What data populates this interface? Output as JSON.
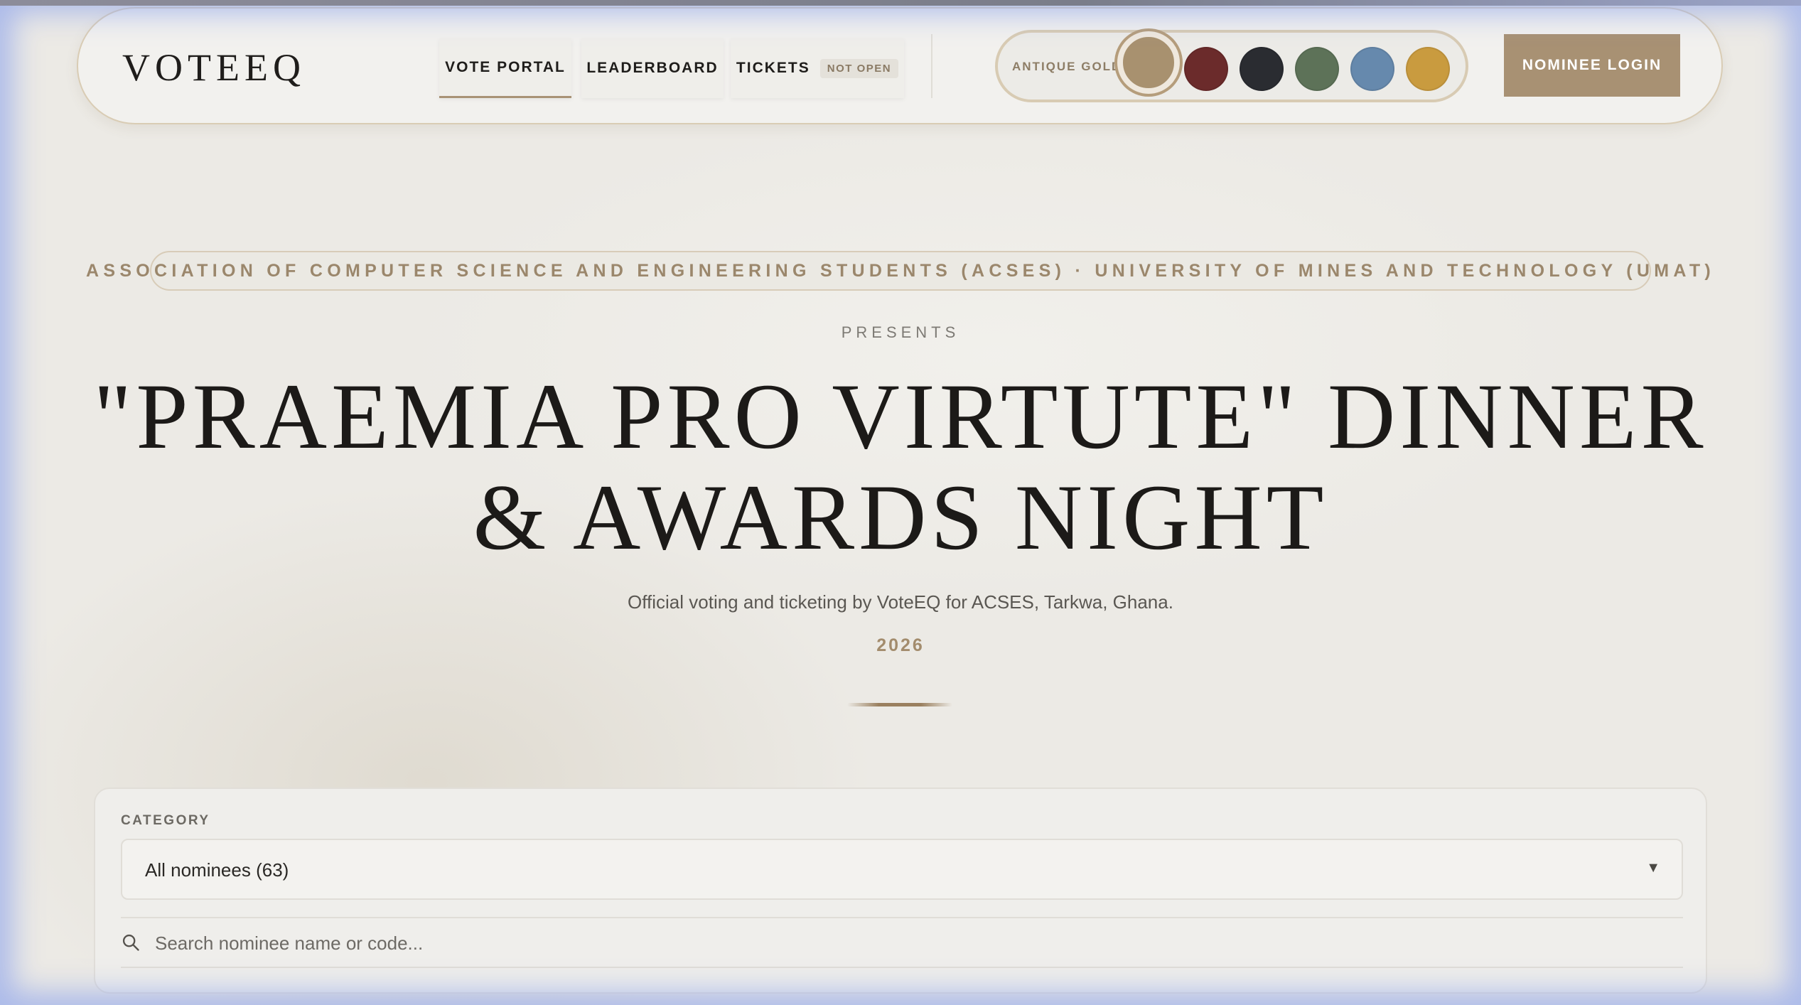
{
  "brand": {
    "logo": "VOTEEQ"
  },
  "nav": {
    "tabs": [
      {
        "label": "VOTE PORTAL",
        "active": true
      },
      {
        "label": "LEADERBOARD",
        "active": false
      },
      {
        "label": "TICKETS",
        "badge": "NOT OPEN",
        "active": false
      }
    ],
    "theme": {
      "selected_label": "ANTIQUE GOLD",
      "swatches": [
        "#a8916f",
        "#6b2b2b",
        "#2a2c31",
        "#5d7258",
        "#6689ad",
        "#c99b3f"
      ]
    },
    "login_button": "NOMINEE LOGIN"
  },
  "hero": {
    "organization": "ASSOCIATION OF COMPUTER SCIENCE AND ENGINEERING STUDENTS (ACSES) · UNIVERSITY OF MINES AND TECHNOLOGY (UMAT)",
    "presents": "PRESENTS",
    "title_line1": "\"PRAEMIA PRO VIRTUTE\" DINNER",
    "title_line2": "& AWARDS NIGHT",
    "subtitle": "Official voting and ticketing by VoteEQ for ACSES, Tarkwa, Ghana.",
    "year": "2026"
  },
  "filters": {
    "category_label": "CATEGORY",
    "category_value": "All nominees (63)",
    "search_placeholder": "Search nominee name or code..."
  },
  "colors": {
    "accent": "#a8916f",
    "accent_text": "#9b876c",
    "background": "#eceae5"
  }
}
